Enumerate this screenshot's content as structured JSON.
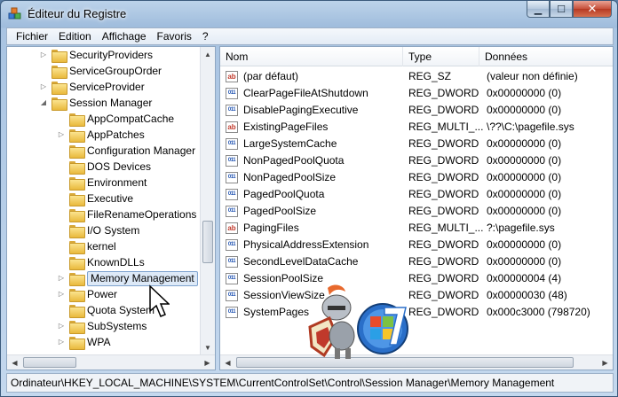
{
  "window": {
    "title": "Éditeur du Registre",
    "icon": "registry-cubes-icon"
  },
  "caption_buttons": {
    "minimize": "minimize-icon",
    "maximize": "maximize-icon",
    "close": "close-icon"
  },
  "menu": [
    "Fichier",
    "Edition",
    "Affichage",
    "Favoris",
    "?"
  ],
  "tree": {
    "selected": "Memory Management",
    "nodes": [
      {
        "label": "SecurityProviders",
        "level": 1,
        "expander": "▷"
      },
      {
        "label": "ServiceGroupOrder",
        "level": 1,
        "expander": ""
      },
      {
        "label": "ServiceProvider",
        "level": 1,
        "expander": "▷"
      },
      {
        "label": "Session Manager",
        "level": 1,
        "expander": "◢"
      },
      {
        "label": "AppCompatCache",
        "level": 2,
        "expander": ""
      },
      {
        "label": "AppPatches",
        "level": 2,
        "expander": "▷"
      },
      {
        "label": "Configuration Manager",
        "level": 2,
        "expander": ""
      },
      {
        "label": "DOS Devices",
        "level": 2,
        "expander": ""
      },
      {
        "label": "Environment",
        "level": 2,
        "expander": ""
      },
      {
        "label": "Executive",
        "level": 2,
        "expander": ""
      },
      {
        "label": "FileRenameOperations",
        "level": 2,
        "expander": ""
      },
      {
        "label": "I/O System",
        "level": 2,
        "expander": ""
      },
      {
        "label": "kernel",
        "level": 2,
        "expander": ""
      },
      {
        "label": "KnownDLLs",
        "level": 2,
        "expander": ""
      },
      {
        "label": "Memory Management",
        "level": 2,
        "expander": "▷"
      },
      {
        "label": "Power",
        "level": 2,
        "expander": "▷"
      },
      {
        "label": "Quota System",
        "level": 2,
        "expander": ""
      },
      {
        "label": "SubSystems",
        "level": 2,
        "expander": "▷"
      },
      {
        "label": "WPA",
        "level": 2,
        "expander": "▷"
      }
    ]
  },
  "list": {
    "columns": [
      "Nom",
      "Type",
      "Données"
    ],
    "rows": [
      {
        "icon": "ab",
        "kind": "sz",
        "name": "(par défaut)",
        "type": "REG_SZ",
        "data": "(valeur non définie)"
      },
      {
        "icon": "011",
        "kind": "bin",
        "name": "ClearPageFileAtShutdown",
        "type": "REG_DWORD",
        "data": "0x00000000 (0)"
      },
      {
        "icon": "011",
        "kind": "bin",
        "name": "DisablePagingExecutive",
        "type": "REG_DWORD",
        "data": "0x00000000 (0)"
      },
      {
        "icon": "ab",
        "kind": "sz",
        "name": "ExistingPageFiles",
        "type": "REG_MULTI_...",
        "data": "\\??\\C:\\pagefile.sys"
      },
      {
        "icon": "011",
        "kind": "bin",
        "name": "LargeSystemCache",
        "type": "REG_DWORD",
        "data": "0x00000000 (0)"
      },
      {
        "icon": "011",
        "kind": "bin",
        "name": "NonPagedPoolQuota",
        "type": "REG_DWORD",
        "data": "0x00000000 (0)"
      },
      {
        "icon": "011",
        "kind": "bin",
        "name": "NonPagedPoolSize",
        "type": "REG_DWORD",
        "data": "0x00000000 (0)"
      },
      {
        "icon": "011",
        "kind": "bin",
        "name": "PagedPoolQuota",
        "type": "REG_DWORD",
        "data": "0x00000000 (0)"
      },
      {
        "icon": "011",
        "kind": "bin",
        "name": "PagedPoolSize",
        "type": "REG_DWORD",
        "data": "0x00000000 (0)"
      },
      {
        "icon": "ab",
        "kind": "sz",
        "name": "PagingFiles",
        "type": "REG_MULTI_...",
        "data": "?:\\pagefile.sys"
      },
      {
        "icon": "011",
        "kind": "bin",
        "name": "PhysicalAddressExtension",
        "type": "REG_DWORD",
        "data": "0x00000000 (0)"
      },
      {
        "icon": "011",
        "kind": "bin",
        "name": "SecondLevelDataCache",
        "type": "REG_DWORD",
        "data": "0x00000000 (0)"
      },
      {
        "icon": "011",
        "kind": "bin",
        "name": "SessionPoolSize",
        "type": "REG_DWORD",
        "data": "0x00000004 (4)"
      },
      {
        "icon": "011",
        "kind": "bin",
        "name": "SessionViewSize",
        "type": "REG_DWORD",
        "data": "0x00000030 (48)"
      },
      {
        "icon": "011",
        "kind": "bin",
        "name": "SystemPages",
        "type": "REG_DWORD",
        "data": "0x000c3000 (798720)"
      }
    ]
  },
  "statusbar": {
    "path": "Ordinateur\\HKEY_LOCAL_MACHINE\\SYSTEM\\CurrentControlSet\\Control\\Session Manager\\Memory Management"
  },
  "overlay": {
    "knight": "knight-mascot-icon",
    "windows7": "windows-7-logo-icon"
  },
  "colors": {
    "selection": "#dde9f7",
    "selection_border": "#7da2ce",
    "title_gradient": "#9fbcdc"
  }
}
